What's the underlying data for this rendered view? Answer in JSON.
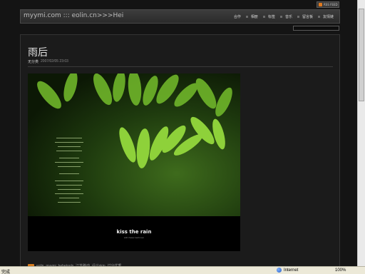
{
  "rss": {
    "label": "RSS FEED"
  },
  "header": {
    "site_title": "myymi.com ::: eolin.cn>>>Hei"
  },
  "nav": {
    "items": [
      {
        "label": "合作"
      },
      {
        "label": "相册"
      },
      {
        "label": "标签"
      },
      {
        "label": "音乐"
      },
      {
        "label": "留言板"
      },
      {
        "label": "友情链"
      }
    ]
  },
  "post": {
    "title": "雨后",
    "category": "无分类",
    "datetime": "2007/02/05 23:03",
    "image_caption": "kiss the rain",
    "image_sub": "with //www.ma3r.com",
    "footer": "eolin, myymi, hehetools, 江苏移动, 设计skin, 过分优秀"
  },
  "statusbar": {
    "status": "完成",
    "zone": "Internet",
    "zoom": "100%"
  },
  "colors": {
    "background": "#141414",
    "header": "#2f2f2f",
    "accent": "#e07a1f",
    "statusbar": "#ece9d8"
  }
}
